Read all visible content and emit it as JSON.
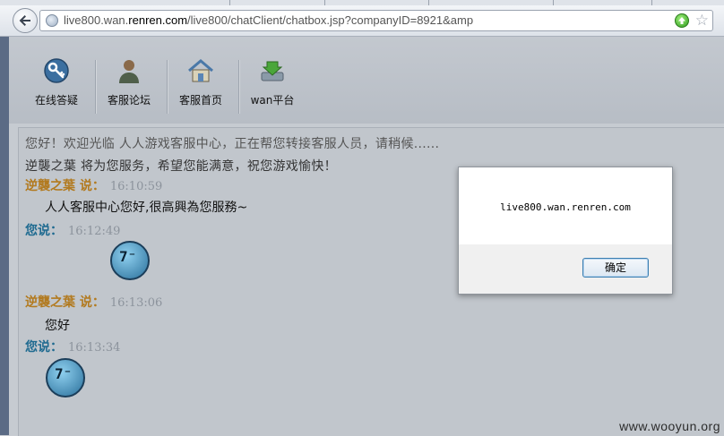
{
  "browser": {
    "url_prefix": "live800.wan.",
    "url_domain": "renren.com",
    "url_suffix": "/live800/chatClient/chatbox.jsp?companyID=8921&amp"
  },
  "toolbar": {
    "items": [
      {
        "label": "在线答疑"
      },
      {
        "label": "客服论坛"
      },
      {
        "label": "客服首页"
      },
      {
        "label": "wan平台"
      }
    ]
  },
  "chat": {
    "system_lines": [
      "您好！欢迎光临 人人游戏客服中心，正在帮您转接客服人员，请稍候......",
      "逆襲之葉 将为您服务，希望您能满意，祝您游戏愉快！"
    ],
    "messages": [
      {
        "sender": "逆襲之葉  说：",
        "time": "16:10:59",
        "text": "人人客服中心您好,很高興為您服務~"
      },
      {
        "sender": "您说：",
        "time": "16:12:49",
        "text": ""
      },
      {
        "sender": "逆襲之葉  说：",
        "time": "16:13:06",
        "text": "您好"
      },
      {
        "sender": "您说：",
        "time": "16:13:34",
        "text": ""
      }
    ]
  },
  "dialog": {
    "message": "live800.wan.renren.com",
    "ok_label": "确定"
  },
  "watermark": "www.wooyun.org",
  "colors": {
    "agent_name": "#b27a1f",
    "user_name": "#1e6a90",
    "go_button": "#2f9a1e"
  }
}
